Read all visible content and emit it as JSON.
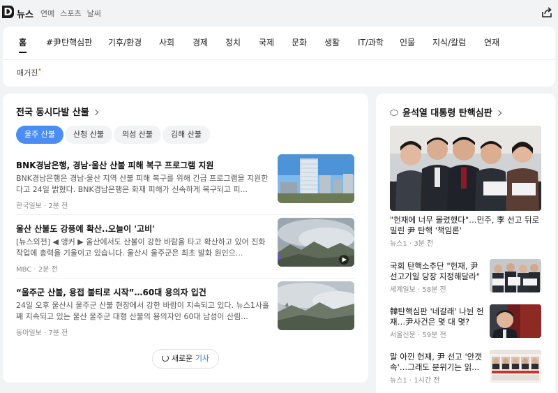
{
  "header": {
    "logo_letter": "D",
    "brand": "뉴스",
    "links": [
      "연예",
      "스포츠",
      "날씨"
    ]
  },
  "nav": {
    "tabs": [
      "홈",
      "#尹탄핵심판",
      "기후/환경",
      "사회",
      "경제",
      "정치",
      "국제",
      "문화",
      "생활",
      "IT/과학",
      "인물",
      "지식/칼럼",
      "연재"
    ],
    "active_tab": "홈",
    "second_row": "매거진",
    "new_dot": "•"
  },
  "left_section": {
    "title": "전국 동시다발 산불",
    "chips": [
      "울주 산불",
      "산청 산불",
      "의성 산불",
      "김해 산불"
    ],
    "active_chip": "울주 산불",
    "articles": [
      {
        "title": "BNK경남은행, 경남·울산 산불 피해 복구 프로그램 지원",
        "body": "BNK경남은행은 경남·울산 지역 산불 피해 복구를 위해 긴급 프로그램을 지원한다고 24일 밝혔다. BNK경남은행은 화재 피해가 신속하게 복구되고 피...",
        "source": "한국일보",
        "time": "2분 전"
      },
      {
        "title": "울산 산불도 강풍에 확산..오늘이 '고비'",
        "body": "[뉴스외전] ◀ 앵커 ▶ 울산에서도 산불이 강한 바람을 타고 확산하고 있어 진화 작업에 총력을 기울이고 있습니다. 울산시 울주군은 최초 발화 원인으...",
        "source": "MBC",
        "time": "2분 전"
      },
      {
        "title": "“울주군 산불, 용접 불티로 시작”…60대 용의자 입건",
        "body": "24일 오후 울산시 울주군 산불 현장에서 강한 바람이 지속되고 있다. 뉴스1사흘째 지속되고 있는 울산 울주군 대형 산불의 용의자인 60대 남성이 산림...",
        "source": "동아일보",
        "time": "7분 전"
      }
    ],
    "more_button": {
      "prefix": "새로운",
      "highlight": "기사"
    }
  },
  "right_section": {
    "title": "윤석열 대통령 탄핵심판",
    "hero": {
      "title": "\"헌재에 너무 몰렸했다\"…민주, 李 선고 뒤로 밀린 尹 탄핵 '책임론'",
      "source": "뉴스1",
      "time": "3분 전"
    },
    "items": [
      {
        "title": "국회 탄핵소추단 \"헌재, 尹 선고기일 당장 지정해달라\"",
        "source": "세계일보",
        "time": "58분 전"
      },
      {
        "title": "韓탄핵심판 '네갈래' 나뉜 헌재…尹사건은 몇 대 몇?",
        "source": "서울신문",
        "time": "59분 전"
      },
      {
        "title": "말 아낀 헌재, 尹 선고 '안갯속'…그래도 분위기는 읽...",
        "source": "뉴스1",
        "time": "1시간 전"
      }
    ]
  },
  "colors": {
    "accent": "#4a8ef5",
    "highlight": "#3a7bea",
    "new_dot": "#f0533a",
    "background": "#f1f3f5"
  }
}
